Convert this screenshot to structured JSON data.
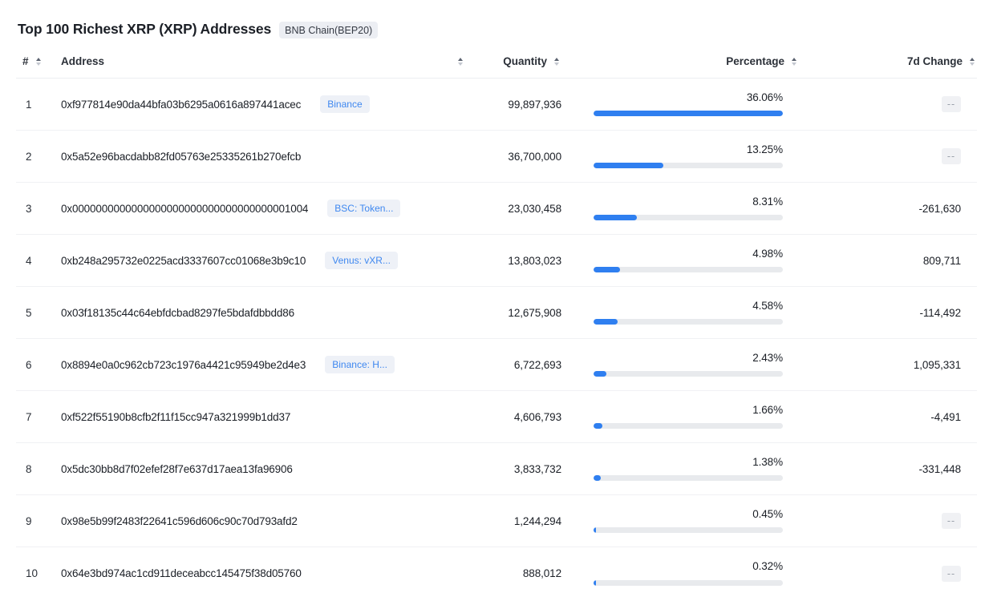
{
  "header": {
    "title": "Top 100 Richest XRP (XRP) Addresses",
    "chain_badge": "BNB Chain(BEP20)"
  },
  "table": {
    "columns": {
      "rank": "#",
      "address": "Address",
      "quantity": "Quantity",
      "percentage": "Percentage",
      "change_7d": "7d Change"
    },
    "colors": {
      "bar_fill": "#2f7ff0",
      "bar_track": "#e8eaed",
      "tag_bg": "#eef1f7",
      "tag_text": "#3f88f0",
      "chain_badge_bg": "#eceef3"
    },
    "empty_value": "--",
    "rows": [
      {
        "rank": "1",
        "address": "0xf977814e90da44bfa03b6295a0616a897441acec",
        "tag": "Binance",
        "quantity": "99,897,936",
        "percentage": "36.06%",
        "percentage_value": 36.06,
        "change_7d": "--",
        "change_is_empty": true
      },
      {
        "rank": "2",
        "address": "0x5a52e96bacdabb82fd05763e25335261b270efcb",
        "tag": "",
        "quantity": "36,700,000",
        "percentage": "13.25%",
        "percentage_value": 13.25,
        "change_7d": "--",
        "change_is_empty": true
      },
      {
        "rank": "3",
        "address": "0x0000000000000000000000000000000000001004",
        "tag": "BSC: Token...",
        "quantity": "23,030,458",
        "percentage": "8.31%",
        "percentage_value": 8.31,
        "change_7d": "-261,630",
        "change_is_empty": false
      },
      {
        "rank": "4",
        "address": "0xb248a295732e0225acd3337607cc01068e3b9c10",
        "tag": "Venus: vXR...",
        "quantity": "13,803,023",
        "percentage": "4.98%",
        "percentage_value": 4.98,
        "change_7d": "809,711",
        "change_is_empty": false
      },
      {
        "rank": "5",
        "address": "0x03f18135c44c64ebfdcbad8297fe5bdafdbbdd86",
        "tag": "",
        "quantity": "12,675,908",
        "percentage": "4.58%",
        "percentage_value": 4.58,
        "change_7d": "-114,492",
        "change_is_empty": false
      },
      {
        "rank": "6",
        "address": "0x8894e0a0c962cb723c1976a4421c95949be2d4e3",
        "tag": "Binance: H...",
        "quantity": "6,722,693",
        "percentage": "2.43%",
        "percentage_value": 2.43,
        "change_7d": "1,095,331",
        "change_is_empty": false
      },
      {
        "rank": "7",
        "address": "0xf522f55190b8cfb2f11f15cc947a321999b1dd37",
        "tag": "",
        "quantity": "4,606,793",
        "percentage": "1.66%",
        "percentage_value": 1.66,
        "change_7d": "-4,491",
        "change_is_empty": false
      },
      {
        "rank": "8",
        "address": "0x5dc30bb8d7f02efef28f7e637d17aea13fa96906",
        "tag": "",
        "quantity": "3,833,732",
        "percentage": "1.38%",
        "percentage_value": 1.38,
        "change_7d": "-331,448",
        "change_is_empty": false
      },
      {
        "rank": "9",
        "address": "0x98e5b99f2483f22641c596d606c90c70d793afd2",
        "tag": "",
        "quantity": "1,244,294",
        "percentage": "0.45%",
        "percentage_value": 0.45,
        "change_7d": "--",
        "change_is_empty": true
      },
      {
        "rank": "10",
        "address": "0x64e3bd974ac1cd911deceabcc145475f38d05760",
        "tag": "",
        "quantity": "888,012",
        "percentage": "0.32%",
        "percentage_value": 0.32,
        "change_7d": "--",
        "change_is_empty": true
      }
    ]
  }
}
